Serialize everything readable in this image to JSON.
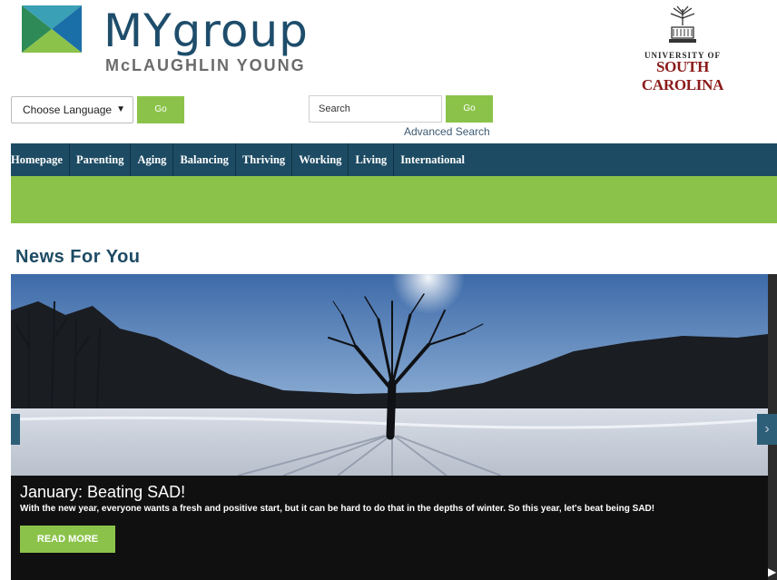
{
  "header": {
    "logo_name": "MYgroup",
    "logo_subtitle": "McLAUGHLIN YOUNG",
    "partner_line1": "UNIVERSITY OF",
    "partner_line2": "SOUTH CAROLINA"
  },
  "controls": {
    "language_selected": "Choose Language",
    "language_go": "Go",
    "search_placeholder": "Search",
    "search_go": "Go",
    "advanced_search": "Advanced Search"
  },
  "nav": {
    "items": [
      "Homepage",
      "Parenting",
      "Aging",
      "Balancing",
      "Thriving",
      "Working",
      "Living",
      "International"
    ]
  },
  "main": {
    "section_title": "News For You",
    "slide": {
      "title": "January: Beating SAD!",
      "text": "With the new year, everyone wants a fresh and positive start, but it can be hard to do that in the depths of winter. So this year, let's beat being SAD!",
      "button": "READ MORE"
    }
  },
  "colors": {
    "brand_navy": "#1d4b63",
    "brand_green": "#8bc34a",
    "usc_garnet": "#8b1a1a"
  },
  "icons": [
    "mygroup-logo-mark",
    "usc-crest-icon",
    "chevron-down-icon",
    "slider-left-arrow-icon",
    "slider-right-arrow-icon",
    "play-icon"
  ]
}
